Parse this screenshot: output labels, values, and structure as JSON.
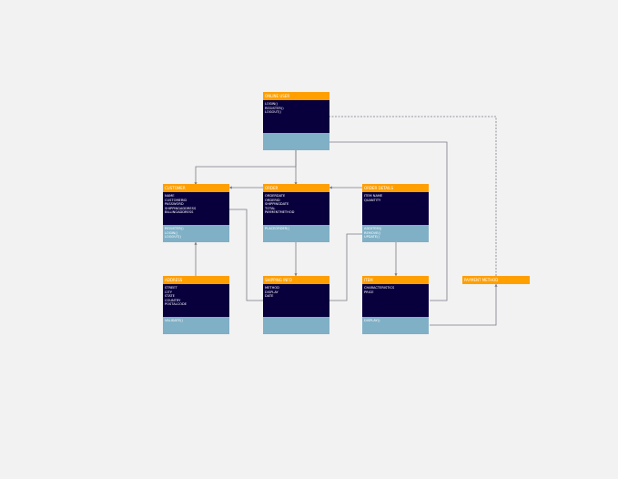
{
  "classes": [
    {
      "id": "c1",
      "title": "ONLINE USER",
      "attributes": [],
      "operations": [
        "LOGIN()",
        "REGISTER()",
        "LOGOUT()"
      ]
    },
    {
      "id": "c2",
      "title": "CUSTOMER",
      "attributes": [
        "NAME",
        "CUSTOMERID",
        "PASSWORD",
        "SHIPPINGADDRESS",
        "BILLINGADDRESS"
      ],
      "operations": [
        "REGISTER()",
        "LOGIN()",
        "LOGOUT()"
      ]
    },
    {
      "id": "c3",
      "title": "ORDER",
      "attributes": [
        "ORDERDATE",
        "ORDERID",
        "SHIPPINGDATE",
        "TOTAL",
        "PAYMENTMETHOD"
      ],
      "operations": [
        "PLACEORDER()"
      ]
    },
    {
      "id": "c4",
      "title": "ORDER DETAILS",
      "attributes": [
        "ITEM NAME",
        "QUANTITY"
      ],
      "operations": [
        "ADDITEM()",
        "REMOVE()",
        "UPDATE()"
      ]
    },
    {
      "id": "c5",
      "title": "ADDRESS",
      "attributes": [
        "STREET",
        "CITY",
        "STATE",
        "COUNTRY",
        "POSTALCODE"
      ],
      "operations": [
        "VALIDATE()"
      ]
    },
    {
      "id": "c6",
      "title": "SHIPPING INFO",
      "attributes": [
        "METHOD",
        "DISPLAY",
        "DATE"
      ],
      "operations": []
    },
    {
      "id": "c7",
      "title": "ITEM",
      "attributes": [
        "CHARACTERISTICS",
        "PRICE"
      ],
      "operations": [
        "DISPLAY()"
      ]
    }
  ],
  "note": {
    "title": "PAYMENT METHOD"
  },
  "colors": {
    "header": "#ff9f00",
    "attributes": "#07003d",
    "operations": "#80b0c6",
    "connector": "#7a7a86"
  }
}
